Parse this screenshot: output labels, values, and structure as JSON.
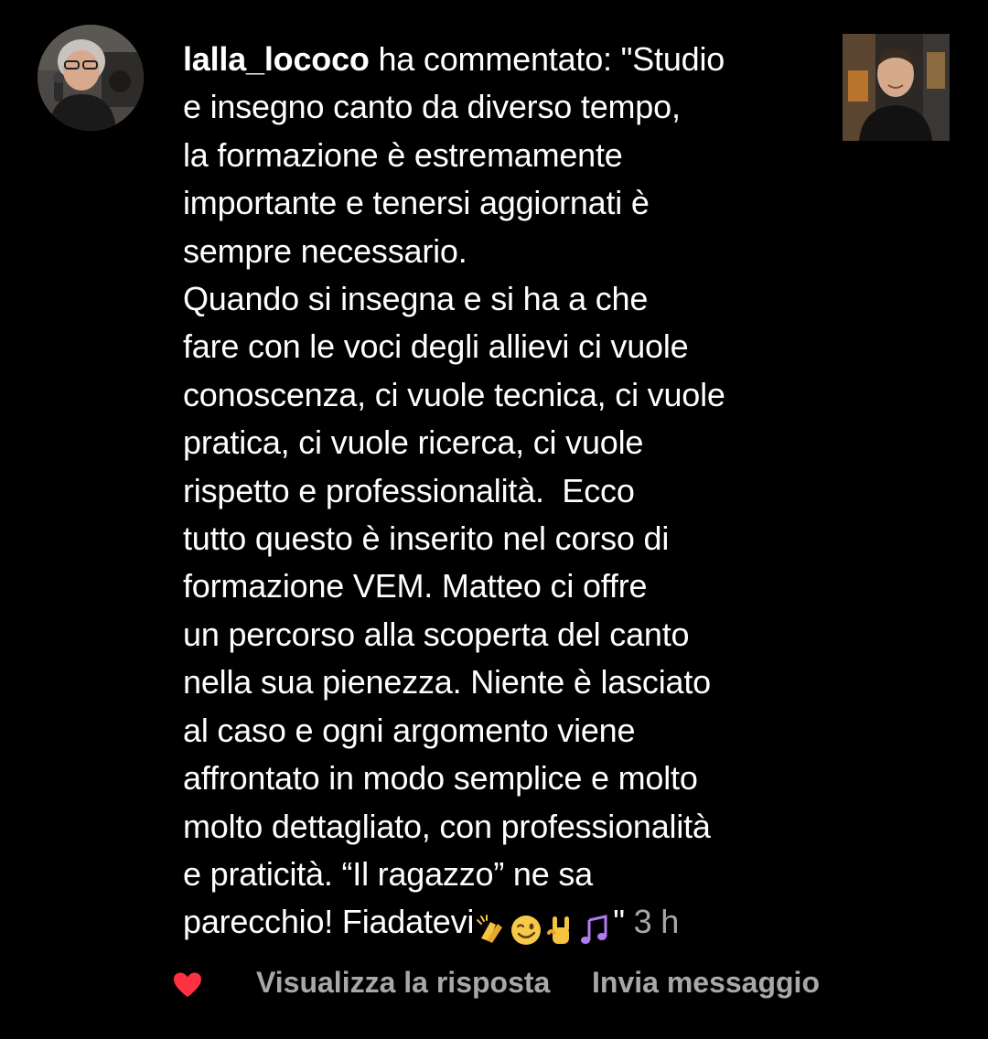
{
  "notification": {
    "username": "lalla_lococo",
    "action_text": " ha commentato: \"Studio",
    "lines": [
      "e insegno canto da diverso tempo,",
      "la formazione è estremamente",
      "importante e tenersi aggiornati è",
      "sempre necessario.",
      "Quando si insegna e si ha a che",
      "fare con le voci degli allievi ci vuole",
      "conoscenza, ci vuole tecnica, ci vuole",
      "pratica, ci vuole ricerca, ci vuole",
      "rispetto e professionalità.  Ecco",
      "tutto questo è inserito nel corso di",
      "formazione VEM. Matteo ci offre",
      "un percorso alla scoperta del canto",
      "nella sua pienezza. Niente è lasciato",
      "al caso e ogni argomento viene",
      "affrontato in modo semplice e molto",
      "molto dettagliato, con professionalità",
      "e praticità. “Il ragazzo” ne sa"
    ],
    "last_line_text": "parecchio! Fiadatevi",
    "emojis": [
      "clapping-hands",
      "winking-face",
      "sign-of-the-horns",
      "musical-notes"
    ],
    "closing_quote": "\"",
    "timestamp": "3 h"
  },
  "actions": {
    "like_icon": "heart-icon",
    "view_reply_label": "Visualizza la risposta",
    "send_message_label": "Invia messaggio"
  },
  "colors": {
    "background": "#000000",
    "text": "#ffffff",
    "secondary_text": "#a8a8a8",
    "heart": "#ff3040"
  }
}
